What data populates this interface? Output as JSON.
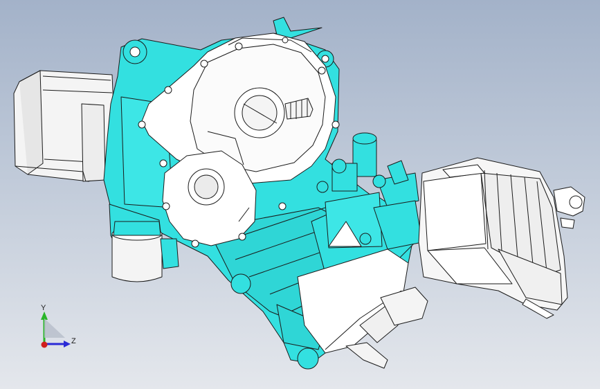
{
  "viewport": {
    "background_top": "#a3b2c9",
    "background_bottom": "#e4e7ec"
  },
  "model": {
    "part_color": "#33e0e0",
    "cover_color": "#ffffff",
    "edge_color": "#1a1a1a"
  },
  "triad": {
    "y_label": "Y",
    "z_label": "Z",
    "y_color": "#29b529",
    "z_color": "#2a2ad6",
    "x_color": "#d01f1f"
  }
}
